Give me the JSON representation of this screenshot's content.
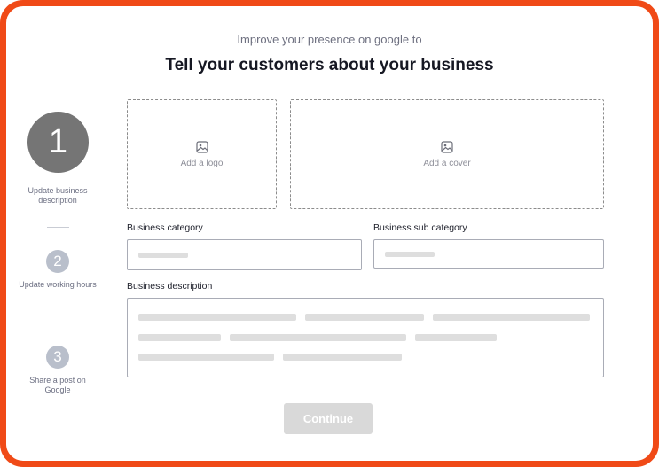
{
  "header": {
    "subtitle": "Improve your presence on google to",
    "title": "Tell your customers about your business"
  },
  "steps": [
    {
      "number": "1",
      "label": "Update business description",
      "state": "active"
    },
    {
      "number": "2",
      "label": "Update working hours",
      "state": "inactive"
    },
    {
      "number": "3",
      "label": "Share a post on Google",
      "state": "inactive"
    }
  ],
  "uploads": {
    "logo_label": "Add a logo",
    "cover_label": "Add a cover",
    "icon": "image-icon"
  },
  "form": {
    "category_label": "Business category",
    "sub_category_label": "Business sub category",
    "description_label": "Business description"
  },
  "actions": {
    "continue_label": "Continue"
  },
  "colors": {
    "frame_border": "#f04a17",
    "active_step": "#757575",
    "inactive_step": "#b9bfcb",
    "disabled_button": "#d9d9d9"
  }
}
